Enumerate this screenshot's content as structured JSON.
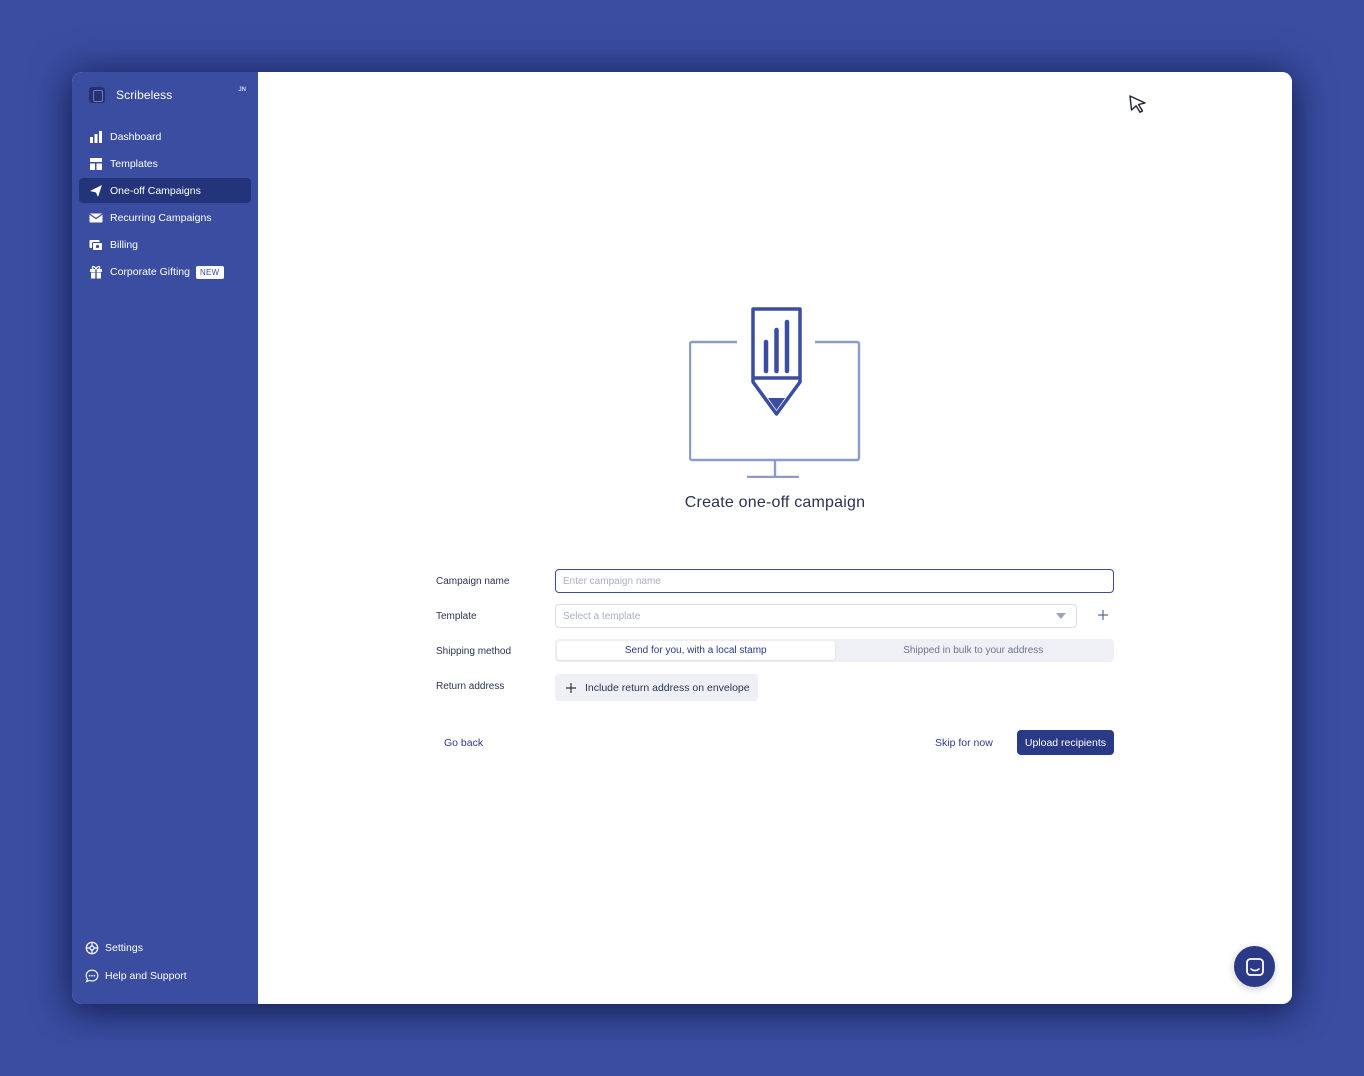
{
  "app": {
    "name": "Scribeless",
    "user_initials": "JN"
  },
  "sidebar": {
    "items": [
      {
        "label": "Dashboard",
        "icon": "bar-chart-icon"
      },
      {
        "label": "Templates",
        "icon": "template-icon"
      },
      {
        "label": "One-off Campaigns",
        "icon": "paper-plane-icon",
        "active": true
      },
      {
        "label": "Recurring Campaigns",
        "icon": "envelope-icon"
      },
      {
        "label": "Billing",
        "icon": "billing-icon"
      },
      {
        "label": "Corporate Gifting",
        "icon": "gift-icon",
        "badge": "NEW"
      }
    ],
    "bottom": [
      {
        "label": "Settings",
        "icon": "gear-icon"
      },
      {
        "label": "Help and Support",
        "icon": "chat-bubble-icon"
      }
    ]
  },
  "main": {
    "title": "Create one-off campaign",
    "form": {
      "campaign_name": {
        "label": "Campaign name",
        "placeholder": "Enter campaign name",
        "value": ""
      },
      "template": {
        "label": "Template",
        "placeholder": "Select a template"
      },
      "shipping": {
        "label": "Shipping method",
        "options": [
          "Send for you, with a local stamp",
          "Shipped in bulk to your address"
        ],
        "selected": 0
      },
      "return_address": {
        "label": "Return address",
        "button": "Include return address on envelope"
      }
    },
    "actions": {
      "back": "Go back",
      "skip": "Skip for now",
      "primary": "Upload recipients"
    }
  },
  "colors": {
    "brand": "#3a4da1",
    "brand_dark": "#2b3a86",
    "active_nav": "#24347a"
  }
}
